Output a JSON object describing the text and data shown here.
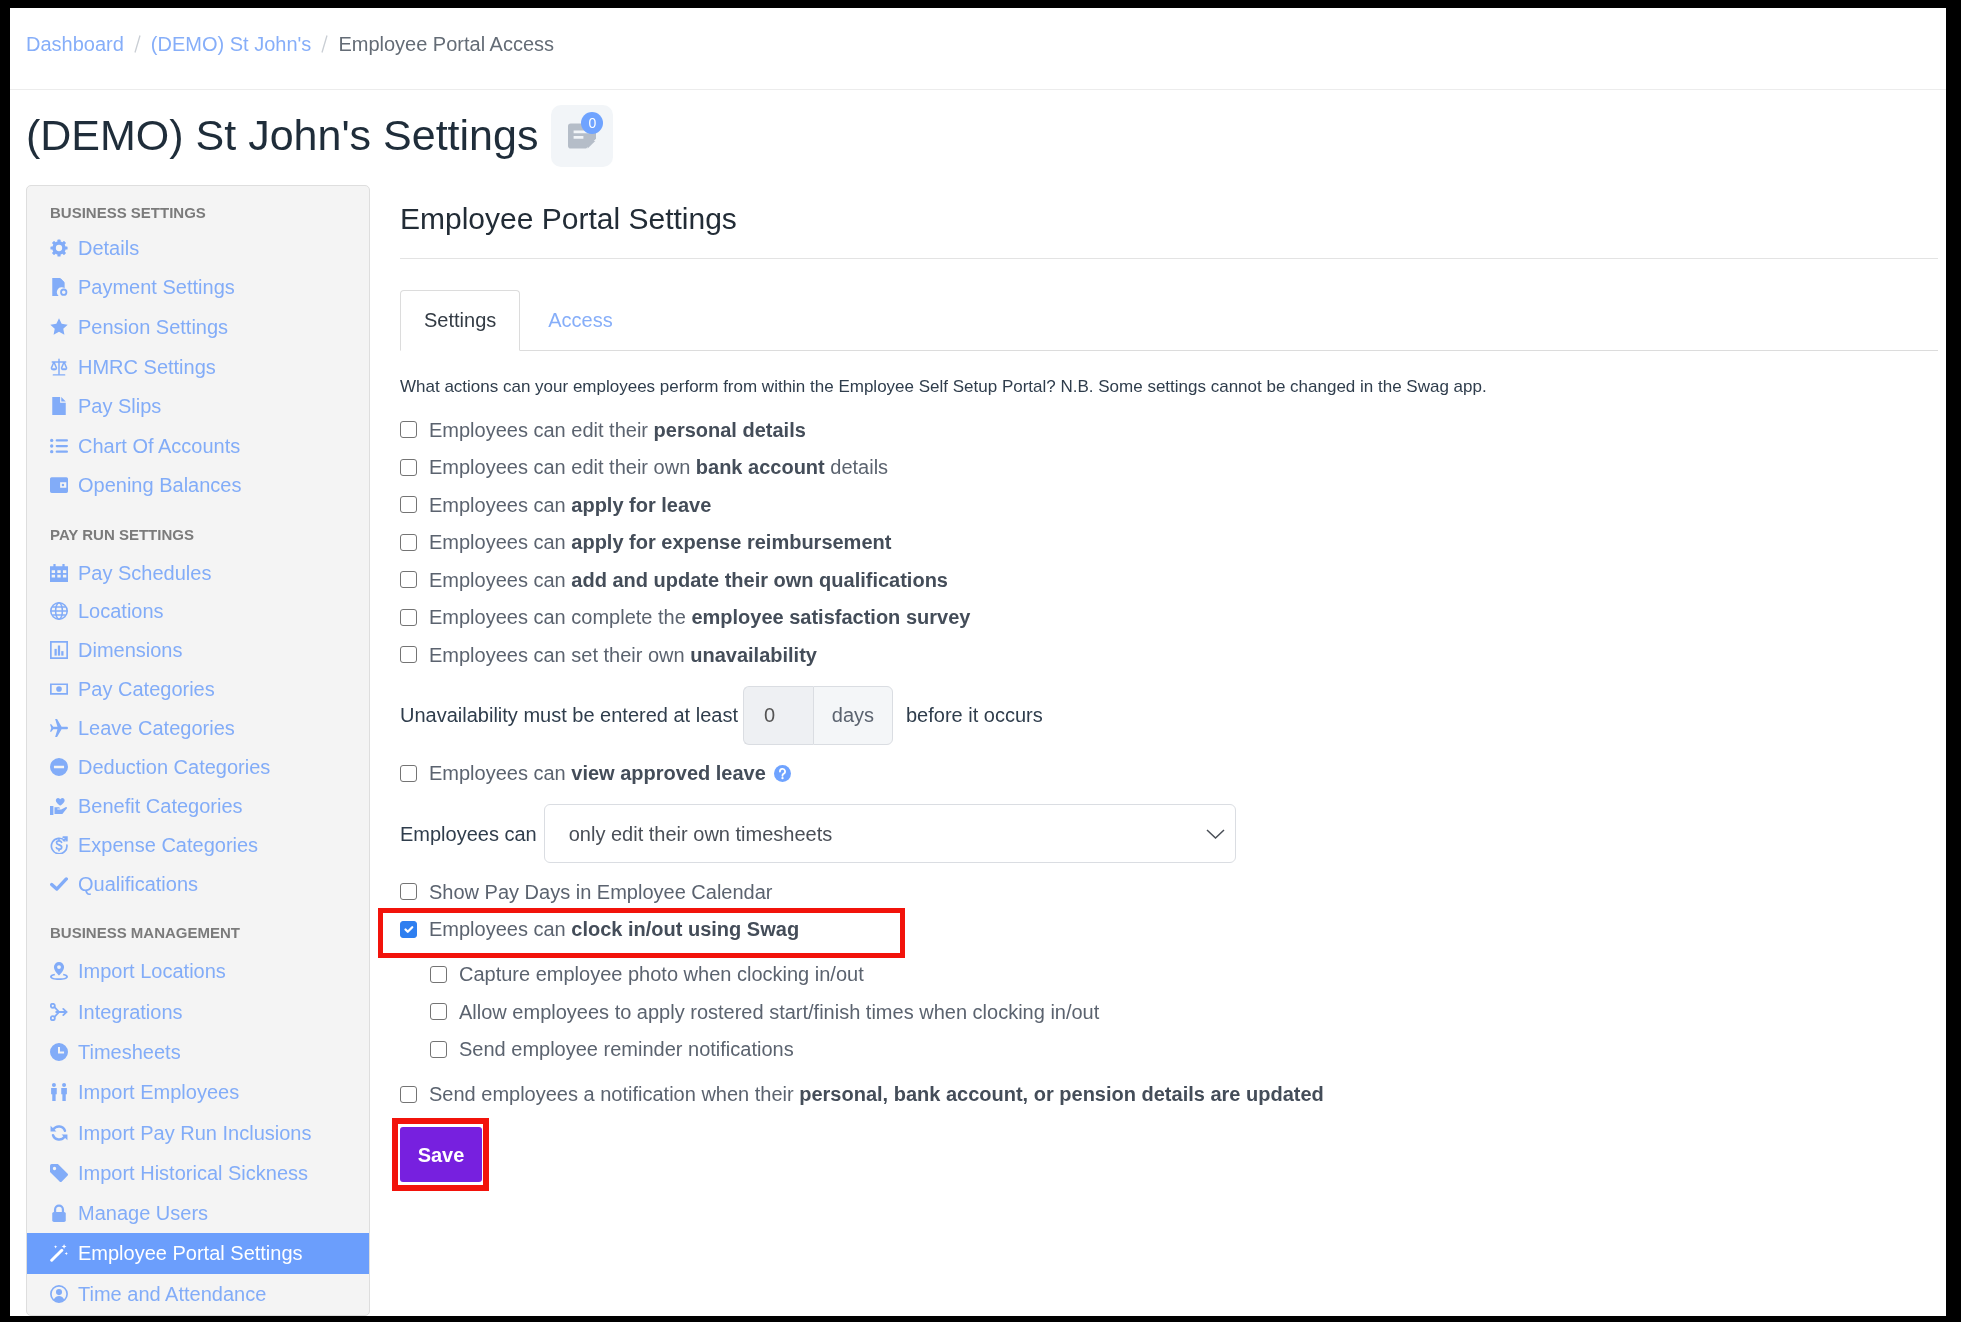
{
  "breadcrumb": [
    {
      "label": "Dashboard",
      "kind": "link"
    },
    {
      "label": "(DEMO) St John's",
      "kind": "link"
    },
    {
      "label": "Employee Portal Access",
      "kind": "current"
    }
  ],
  "page_title": "(DEMO) St John's Settings",
  "notes_count": "0",
  "sidebar": {
    "sections": [
      {
        "heading": "BUSINESS SETTINGS",
        "items": [
          {
            "label": "Details",
            "selected": false
          },
          {
            "label": "Payment Settings",
            "selected": false
          },
          {
            "label": "Pension Settings",
            "selected": false
          },
          {
            "label": "HMRC Settings",
            "selected": false
          },
          {
            "label": "Pay Slips",
            "selected": false
          },
          {
            "label": "Chart Of Accounts",
            "selected": false
          },
          {
            "label": "Opening Balances",
            "selected": false
          }
        ]
      },
      {
        "heading": "PAY RUN SETTINGS",
        "items": [
          {
            "label": "Pay Schedules",
            "selected": false
          },
          {
            "label": "Locations",
            "selected": false
          },
          {
            "label": "Dimensions",
            "selected": false
          },
          {
            "label": "Pay Categories",
            "selected": false
          },
          {
            "label": "Leave Categories",
            "selected": false
          },
          {
            "label": "Deduction Categories",
            "selected": false
          },
          {
            "label": "Benefit Categories",
            "selected": false
          },
          {
            "label": "Expense Categories",
            "selected": false
          },
          {
            "label": "Qualifications",
            "selected": false
          }
        ]
      },
      {
        "heading": "BUSINESS MANAGEMENT",
        "items": [
          {
            "label": "Import Locations",
            "selected": false
          },
          {
            "label": "Integrations",
            "selected": false
          },
          {
            "label": "Timesheets",
            "selected": false
          },
          {
            "label": "Import Employees",
            "selected": false
          },
          {
            "label": "Import Pay Run Inclusions",
            "selected": false
          },
          {
            "label": "Import Historical Sickness",
            "selected": false
          },
          {
            "label": "Manage Users",
            "selected": false
          },
          {
            "label": "Employee Portal Settings",
            "selected": true
          },
          {
            "label": "Time and Attendance",
            "selected": false
          }
        ]
      }
    ]
  },
  "panel": {
    "title": "Employee Portal Settings",
    "tabs": [
      {
        "label": "Settings",
        "selected": true
      },
      {
        "label": "Access",
        "selected": false
      }
    ],
    "intro": "What actions can your employees perform from within the Employee Self Setup Portal? N.B. Some settings cannot be changed in the Swag app.",
    "options": [
      {
        "kind": "checkbox",
        "label": "Employees can edit their **personal details**",
        "checked": false,
        "highlighted": false
      },
      {
        "kind": "checkbox",
        "label": "Employees can edit their own **bank account** details",
        "checked": false,
        "highlighted": false
      },
      {
        "kind": "checkbox",
        "label": "Employees can **apply for leave**",
        "checked": false,
        "highlighted": false
      },
      {
        "kind": "checkbox",
        "label": "Employees can **apply for expense reimbursement**",
        "checked": false,
        "highlighted": false
      },
      {
        "kind": "checkbox",
        "label": "Employees can **add and update their own qualifications**",
        "checked": false,
        "highlighted": false
      },
      {
        "kind": "checkbox",
        "label": "Employees can complete the **employee satisfaction survey**",
        "checked": false,
        "highlighted": false
      },
      {
        "kind": "checkbox",
        "label": "Employees can set their own **unavailability**",
        "checked": false,
        "highlighted": false
      },
      {
        "kind": "days_input",
        "label": "Unavailability must be entered at least",
        "value": "0",
        "unit": "days",
        "suffix": "before it occurs",
        "disabled": true,
        "highlighted": false
      },
      {
        "kind": "checkbox",
        "label": "Employees can **view approved leave**",
        "checked": false,
        "help": true,
        "highlighted": false
      },
      {
        "kind": "select",
        "label": "Employees can",
        "value": "only edit their own timesheets",
        "highlighted": false
      },
      {
        "kind": "checkbox",
        "label": "Show Pay Days in Employee Calendar",
        "checked": false,
        "highlighted": false
      },
      {
        "kind": "checkbox",
        "label": "Employees can **clock in/out using Swag**",
        "checked": true,
        "highlighted": true,
        "children": [
          {
            "kind": "checkbox",
            "label": "Capture employee photo when clocking in/out",
            "checked": false,
            "highlighted": false
          },
          {
            "kind": "checkbox",
            "label": "Allow employees to apply rostered start/finish times when clocking in/out",
            "checked": false,
            "highlighted": false
          },
          {
            "kind": "checkbox",
            "label": "Send employee reminder notifications",
            "checked": false,
            "highlighted": false
          }
        ]
      },
      {
        "kind": "checkbox",
        "label": "Send employees a notification when their **personal, bank account, or pension details are updated**",
        "checked": false,
        "highlighted": false
      }
    ],
    "save_button": {
      "label": "Save",
      "highlighted": true
    }
  }
}
